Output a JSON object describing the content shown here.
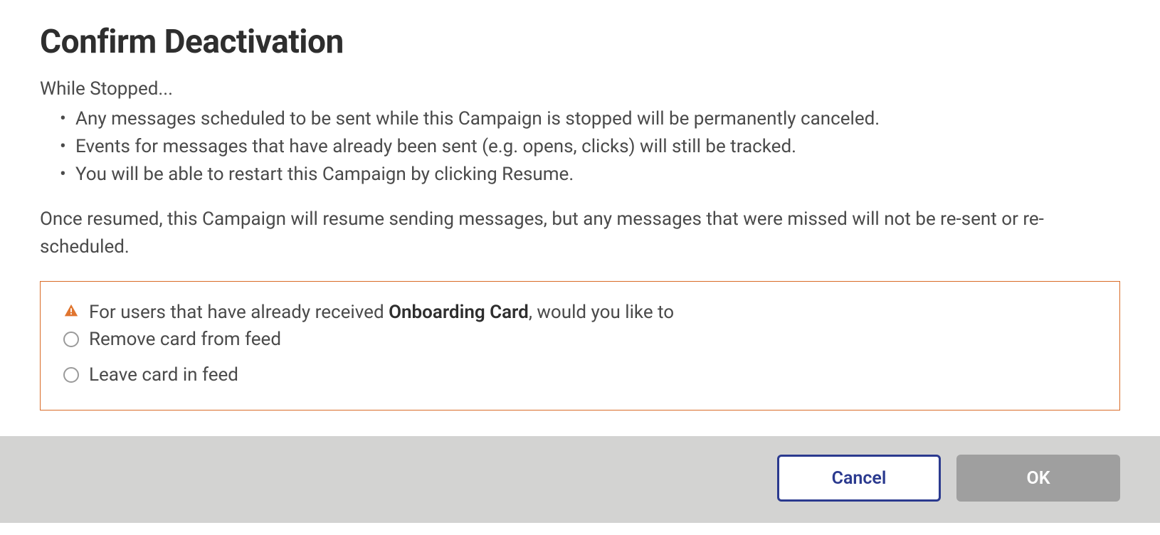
{
  "dialog": {
    "title": "Confirm Deactivation",
    "intro": "While Stopped...",
    "bullets": [
      "Any messages scheduled to be sent while this Campaign is stopped will be permanently canceled.",
      "Events for messages that have already been sent (e.g. opens, clicks) will still be tracked.",
      "You will be able to restart this Campaign by clicking Resume."
    ],
    "resume_note": "Once resumed, this Campaign will resume sending messages, but any messages that were missed will not be re-sent or re-scheduled.",
    "warning": {
      "prefix": "For users that have already received ",
      "card_name": "Onboarding Card",
      "suffix": ", would you like to",
      "options": [
        {
          "label": "Remove card from feed"
        },
        {
          "label": "Leave card in feed"
        }
      ]
    },
    "buttons": {
      "cancel": "Cancel",
      "ok": "OK"
    }
  }
}
